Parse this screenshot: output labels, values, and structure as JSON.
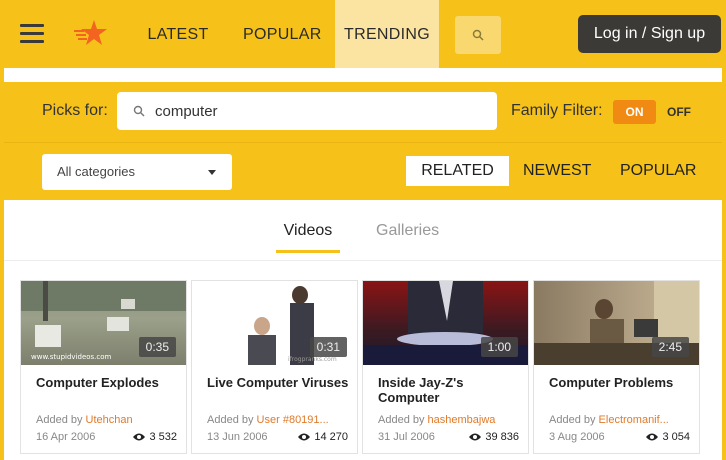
{
  "nav": {
    "latest": "LATEST",
    "popular": "POPULAR",
    "trending": "TRENDING",
    "login": "Log in / Sign up"
  },
  "picks": {
    "label": "Picks for:",
    "query": "computer",
    "family_filter_label": "Family Filter:",
    "toggle_on": "ON",
    "toggle_off": "OFF"
  },
  "filter": {
    "category": "All categories",
    "sort_related": "RELATED",
    "sort_newest": "NEWEST",
    "sort_popular": "POPULAR"
  },
  "tabs": {
    "videos": "Videos",
    "galleries": "Galleries"
  },
  "videos": [
    {
      "title": "Computer Explodes",
      "duration": "0:35",
      "added_by": "Added by",
      "user": "Utehchan",
      "date": "16 Apr 2006",
      "views": "3 532"
    },
    {
      "title": "Live Computer Viruses",
      "duration": "0:31",
      "added_by": "Added by",
      "user": "User #80191...",
      "date": "13 Jun 2006",
      "views": "14 270"
    },
    {
      "title": "Inside Jay-Z's Computer",
      "duration": "1:00",
      "added_by": "Added by",
      "user": "hashembajwa",
      "date": "31 Jul 2006",
      "views": "39 836"
    },
    {
      "title": "Computer Problems",
      "duration": "2:45",
      "added_by": "Added by",
      "user": "Electromanif...",
      "date": "3 Aug 2006",
      "views": "3 054"
    }
  ],
  "colors": {
    "brand_yellow": "#f6c21a",
    "active_nav": "#fbe3a1",
    "toggle_on": "#f08a12",
    "login_bg": "#3b3a36",
    "user_link": "#e07a2a"
  }
}
